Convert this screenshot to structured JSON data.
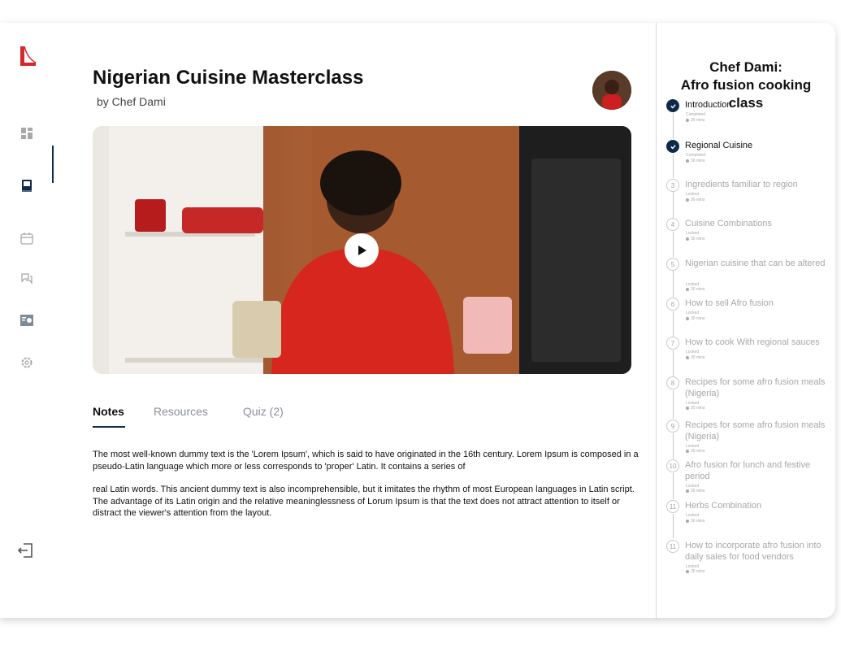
{
  "course": {
    "title": "Nigerian Cuisine Masterclass",
    "byline": "by Chef Dami",
    "panel_title_line1": "Chef Dami:",
    "panel_title_line2": "Afro fusion cooking class"
  },
  "tabs": [
    {
      "label": "Notes",
      "active": true
    },
    {
      "label": "Resources",
      "active": false
    },
    {
      "label": "Quiz (2)",
      "active": false
    }
  ],
  "notes": {
    "paragraph1": "The most well-known dummy text is the 'Lorem Ipsum', which is said to have originated in the 16th century. Lorem Ipsum is composed in a pseudo-Latin language which more or less corresponds to 'proper' Latin. It contains a series of",
    "paragraph2": "real Latin words. This ancient dummy text is also incomprehensible, but it imitates the rhythm of most European languages in Latin script. The advantage of its Latin origin and the relative meaninglessness of Lorum Ipsum is that the text does not attract attention to itself or distract the viewer's attention from the layout."
  },
  "lessons": [
    {
      "num": "",
      "title": "Introduction",
      "status": "Completed",
      "duration": "30 mins",
      "completed": true
    },
    {
      "num": "",
      "title": "Regional Cuisine",
      "status": "Completed",
      "duration": "30 mins",
      "completed": true
    },
    {
      "num": "3",
      "title": "Ingredients familiar to region",
      "status": "Locked",
      "duration": "30 mins",
      "completed": false
    },
    {
      "num": "4",
      "title": "Cuisine Combinations",
      "status": "Locked",
      "duration": "30 mins",
      "completed": false
    },
    {
      "num": "5",
      "title": "Nigerian cuisine that can be altered",
      "status": "Locked",
      "duration": "30 mins",
      "completed": false
    },
    {
      "num": "6",
      "title": "How to sell Afro fusion",
      "status": "Locked",
      "duration": "30 mins",
      "completed": false
    },
    {
      "num": "7",
      "title": "How to cook With regional sauces",
      "status": "Locked",
      "duration": "30 mins",
      "completed": false
    },
    {
      "num": "8",
      "title": "Recipes for some afro fusion meals (Nigeria)",
      "status": "Locked",
      "duration": "30 mins",
      "completed": false
    },
    {
      "num": "9",
      "title": "Recipes for some afro fusion meals (Nigeria)",
      "status": "Locked",
      "duration": "30 mins",
      "completed": false
    },
    {
      "num": "10",
      "title": "Afro fusion for lunch and festive period",
      "status": "Locked",
      "duration": "30 mins",
      "completed": false
    },
    {
      "num": "11",
      "title": "Herbs Combination",
      "status": "Locked",
      "duration": "30 mins",
      "completed": false
    },
    {
      "num": "11",
      "title": "How to incorporate afro fusion into daily sales for food vendors",
      "status": "Locked",
      "duration": "30 mins",
      "completed": false
    }
  ],
  "colors": {
    "accent": "#0e2a4b",
    "logo_red": "#d62828",
    "muted": "#a8a8a8"
  },
  "icons": {
    "nav": [
      "dashboard-icon",
      "book-icon",
      "calendar-icon",
      "chat-icon",
      "certificate-icon",
      "settings-icon"
    ],
    "logout": "logout-icon",
    "play": "play-icon",
    "check": "check-icon"
  }
}
